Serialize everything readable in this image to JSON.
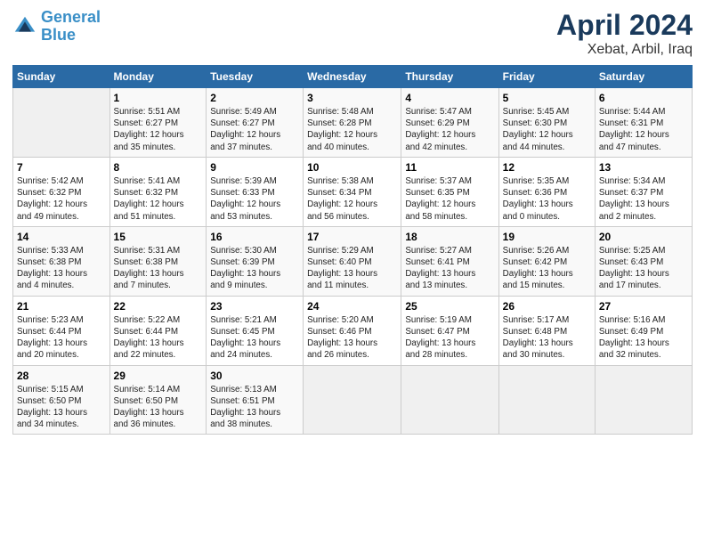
{
  "header": {
    "logo_line1": "General",
    "logo_line2": "Blue",
    "title": "April 2024",
    "subtitle": "Xebat, Arbil, Iraq"
  },
  "weekdays": [
    "Sunday",
    "Monday",
    "Tuesday",
    "Wednesday",
    "Thursday",
    "Friday",
    "Saturday"
  ],
  "weeks": [
    [
      {
        "day": "",
        "info": ""
      },
      {
        "day": "1",
        "info": "Sunrise: 5:51 AM\nSunset: 6:27 PM\nDaylight: 12 hours\nand 35 minutes."
      },
      {
        "day": "2",
        "info": "Sunrise: 5:49 AM\nSunset: 6:27 PM\nDaylight: 12 hours\nand 37 minutes."
      },
      {
        "day": "3",
        "info": "Sunrise: 5:48 AM\nSunset: 6:28 PM\nDaylight: 12 hours\nand 40 minutes."
      },
      {
        "day": "4",
        "info": "Sunrise: 5:47 AM\nSunset: 6:29 PM\nDaylight: 12 hours\nand 42 minutes."
      },
      {
        "day": "5",
        "info": "Sunrise: 5:45 AM\nSunset: 6:30 PM\nDaylight: 12 hours\nand 44 minutes."
      },
      {
        "day": "6",
        "info": "Sunrise: 5:44 AM\nSunset: 6:31 PM\nDaylight: 12 hours\nand 47 minutes."
      }
    ],
    [
      {
        "day": "7",
        "info": "Sunrise: 5:42 AM\nSunset: 6:32 PM\nDaylight: 12 hours\nand 49 minutes."
      },
      {
        "day": "8",
        "info": "Sunrise: 5:41 AM\nSunset: 6:32 PM\nDaylight: 12 hours\nand 51 minutes."
      },
      {
        "day": "9",
        "info": "Sunrise: 5:39 AM\nSunset: 6:33 PM\nDaylight: 12 hours\nand 53 minutes."
      },
      {
        "day": "10",
        "info": "Sunrise: 5:38 AM\nSunset: 6:34 PM\nDaylight: 12 hours\nand 56 minutes."
      },
      {
        "day": "11",
        "info": "Sunrise: 5:37 AM\nSunset: 6:35 PM\nDaylight: 12 hours\nand 58 minutes."
      },
      {
        "day": "12",
        "info": "Sunrise: 5:35 AM\nSunset: 6:36 PM\nDaylight: 13 hours\nand 0 minutes."
      },
      {
        "day": "13",
        "info": "Sunrise: 5:34 AM\nSunset: 6:37 PM\nDaylight: 13 hours\nand 2 minutes."
      }
    ],
    [
      {
        "day": "14",
        "info": "Sunrise: 5:33 AM\nSunset: 6:38 PM\nDaylight: 13 hours\nand 4 minutes."
      },
      {
        "day": "15",
        "info": "Sunrise: 5:31 AM\nSunset: 6:38 PM\nDaylight: 13 hours\nand 7 minutes."
      },
      {
        "day": "16",
        "info": "Sunrise: 5:30 AM\nSunset: 6:39 PM\nDaylight: 13 hours\nand 9 minutes."
      },
      {
        "day": "17",
        "info": "Sunrise: 5:29 AM\nSunset: 6:40 PM\nDaylight: 13 hours\nand 11 minutes."
      },
      {
        "day": "18",
        "info": "Sunrise: 5:27 AM\nSunset: 6:41 PM\nDaylight: 13 hours\nand 13 minutes."
      },
      {
        "day": "19",
        "info": "Sunrise: 5:26 AM\nSunset: 6:42 PM\nDaylight: 13 hours\nand 15 minutes."
      },
      {
        "day": "20",
        "info": "Sunrise: 5:25 AM\nSunset: 6:43 PM\nDaylight: 13 hours\nand 17 minutes."
      }
    ],
    [
      {
        "day": "21",
        "info": "Sunrise: 5:23 AM\nSunset: 6:44 PM\nDaylight: 13 hours\nand 20 minutes."
      },
      {
        "day": "22",
        "info": "Sunrise: 5:22 AM\nSunset: 6:44 PM\nDaylight: 13 hours\nand 22 minutes."
      },
      {
        "day": "23",
        "info": "Sunrise: 5:21 AM\nSunset: 6:45 PM\nDaylight: 13 hours\nand 24 minutes."
      },
      {
        "day": "24",
        "info": "Sunrise: 5:20 AM\nSunset: 6:46 PM\nDaylight: 13 hours\nand 26 minutes."
      },
      {
        "day": "25",
        "info": "Sunrise: 5:19 AM\nSunset: 6:47 PM\nDaylight: 13 hours\nand 28 minutes."
      },
      {
        "day": "26",
        "info": "Sunrise: 5:17 AM\nSunset: 6:48 PM\nDaylight: 13 hours\nand 30 minutes."
      },
      {
        "day": "27",
        "info": "Sunrise: 5:16 AM\nSunset: 6:49 PM\nDaylight: 13 hours\nand 32 minutes."
      }
    ],
    [
      {
        "day": "28",
        "info": "Sunrise: 5:15 AM\nSunset: 6:50 PM\nDaylight: 13 hours\nand 34 minutes."
      },
      {
        "day": "29",
        "info": "Sunrise: 5:14 AM\nSunset: 6:50 PM\nDaylight: 13 hours\nand 36 minutes."
      },
      {
        "day": "30",
        "info": "Sunrise: 5:13 AM\nSunset: 6:51 PM\nDaylight: 13 hours\nand 38 minutes."
      },
      {
        "day": "",
        "info": ""
      },
      {
        "day": "",
        "info": ""
      },
      {
        "day": "",
        "info": ""
      },
      {
        "day": "",
        "info": ""
      }
    ]
  ]
}
